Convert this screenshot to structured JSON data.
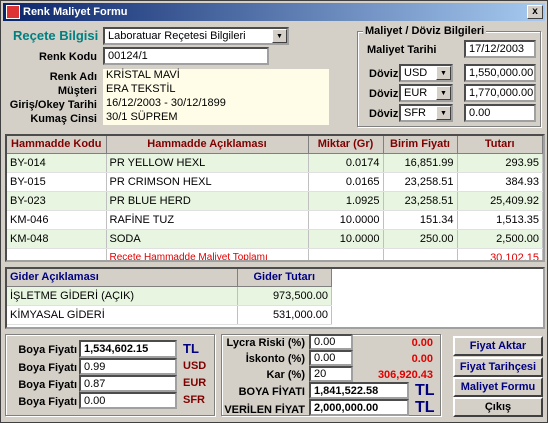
{
  "window": {
    "title": "Renk Maliyet Formu",
    "close": "x"
  },
  "header": {
    "recete_label": "Reçete Bilgisi",
    "recete_value": "Laboratuar Reçetesi Bilgileri",
    "renk_kodu_label": "Renk Kodu",
    "renk_kodu_value": "00124/1",
    "renk_adi_label": "Renk Adı",
    "renk_adi_value": "KRİSTAL MAVİ",
    "musteri_label": "Müşteri",
    "musteri_value": "ERA TEKSTİL",
    "giris_label": "Giriş/Okey Tarihi",
    "giris_value": "16/12/2003  -  30/12/1899",
    "kumas_label": "Kumaş Cinsi",
    "kumas_value": "30/1 SÜPREM"
  },
  "doviz": {
    "title": "Maliyet / Döviz Bilgileri",
    "tarih_label": "Maliyet Tarihi",
    "tarih_value": "17/12/2003",
    "rows": [
      {
        "label": "Döviz",
        "currency": "USD",
        "value": "1,550,000.00"
      },
      {
        "label": "Döviz",
        "currency": "EUR",
        "value": "1,770,000.00"
      },
      {
        "label": "Döviz",
        "currency": "SFR",
        "value": "0.00"
      }
    ]
  },
  "hammadde": {
    "headers": [
      "Hammadde Kodu",
      "Hammadde Açıklaması",
      "Miktar (Gr)",
      "Birim Fiyatı",
      "Tutarı"
    ],
    "rows": [
      [
        "BY-014",
        "PR YELLOW HEXL",
        "0.0174",
        "16,851.99",
        "293.95"
      ],
      [
        "BY-015",
        "PR CRIMSON HEXL",
        "0.0165",
        "23,258.51",
        "384.93"
      ],
      [
        "BY-023",
        "PR BLUE HERD",
        "1.0925",
        "23,258.51",
        "25,409.92"
      ],
      [
        "KM-046",
        "RAFİNE TUZ",
        "10.0000",
        "151.34",
        "1,513.35"
      ],
      [
        "KM-048",
        "SODA",
        "10.0000",
        "250.00",
        "2,500.00"
      ]
    ],
    "total_label": "Reçete Hammadde Maliyet Toplamı",
    "total_value": "30,102.15"
  },
  "gider": {
    "headers": [
      "Gider Açıklaması",
      "Gider Tutarı"
    ],
    "rows": [
      [
        "İŞLETME GİDERİ (AÇIK)",
        "973,500.00"
      ],
      [
        "KİMYASAL GİDERİ",
        "531,000.00"
      ]
    ]
  },
  "boya": {
    "label": "Boya Fiyatı",
    "rows": [
      {
        "value": "1,534,602.15",
        "currency": "TL"
      },
      {
        "value": "0.99",
        "currency": "USD"
      },
      {
        "value": "0.87",
        "currency": "EUR"
      },
      {
        "value": "0.00",
        "currency": "SFR"
      }
    ]
  },
  "risk": {
    "lycra_label": "Lycra Riski (%)",
    "lycra_value": "0.00",
    "lycra_result": "0.00",
    "iskonto_label": "İskonto (%)",
    "iskonto_value": "0.00",
    "iskonto_result": "0.00",
    "kar_label": "Kar (%)",
    "kar_value": "20",
    "kar_result": "306,920.43",
    "boya_fiyati_label": "BOYA FİYATI",
    "boya_fiyati_value": "1,841,522.58",
    "boya_fiyati_cur": "TL",
    "verilen_label": "VERİLEN FİYAT",
    "verilen_value": "2,000,000.00",
    "verilen_cur": "TL"
  },
  "buttons": {
    "aktar": "Fiyat Aktar",
    "tarihce": "Fiyat Tarihçesi",
    "formu": "Maliyet Formu",
    "cikis": "Çıkış"
  }
}
